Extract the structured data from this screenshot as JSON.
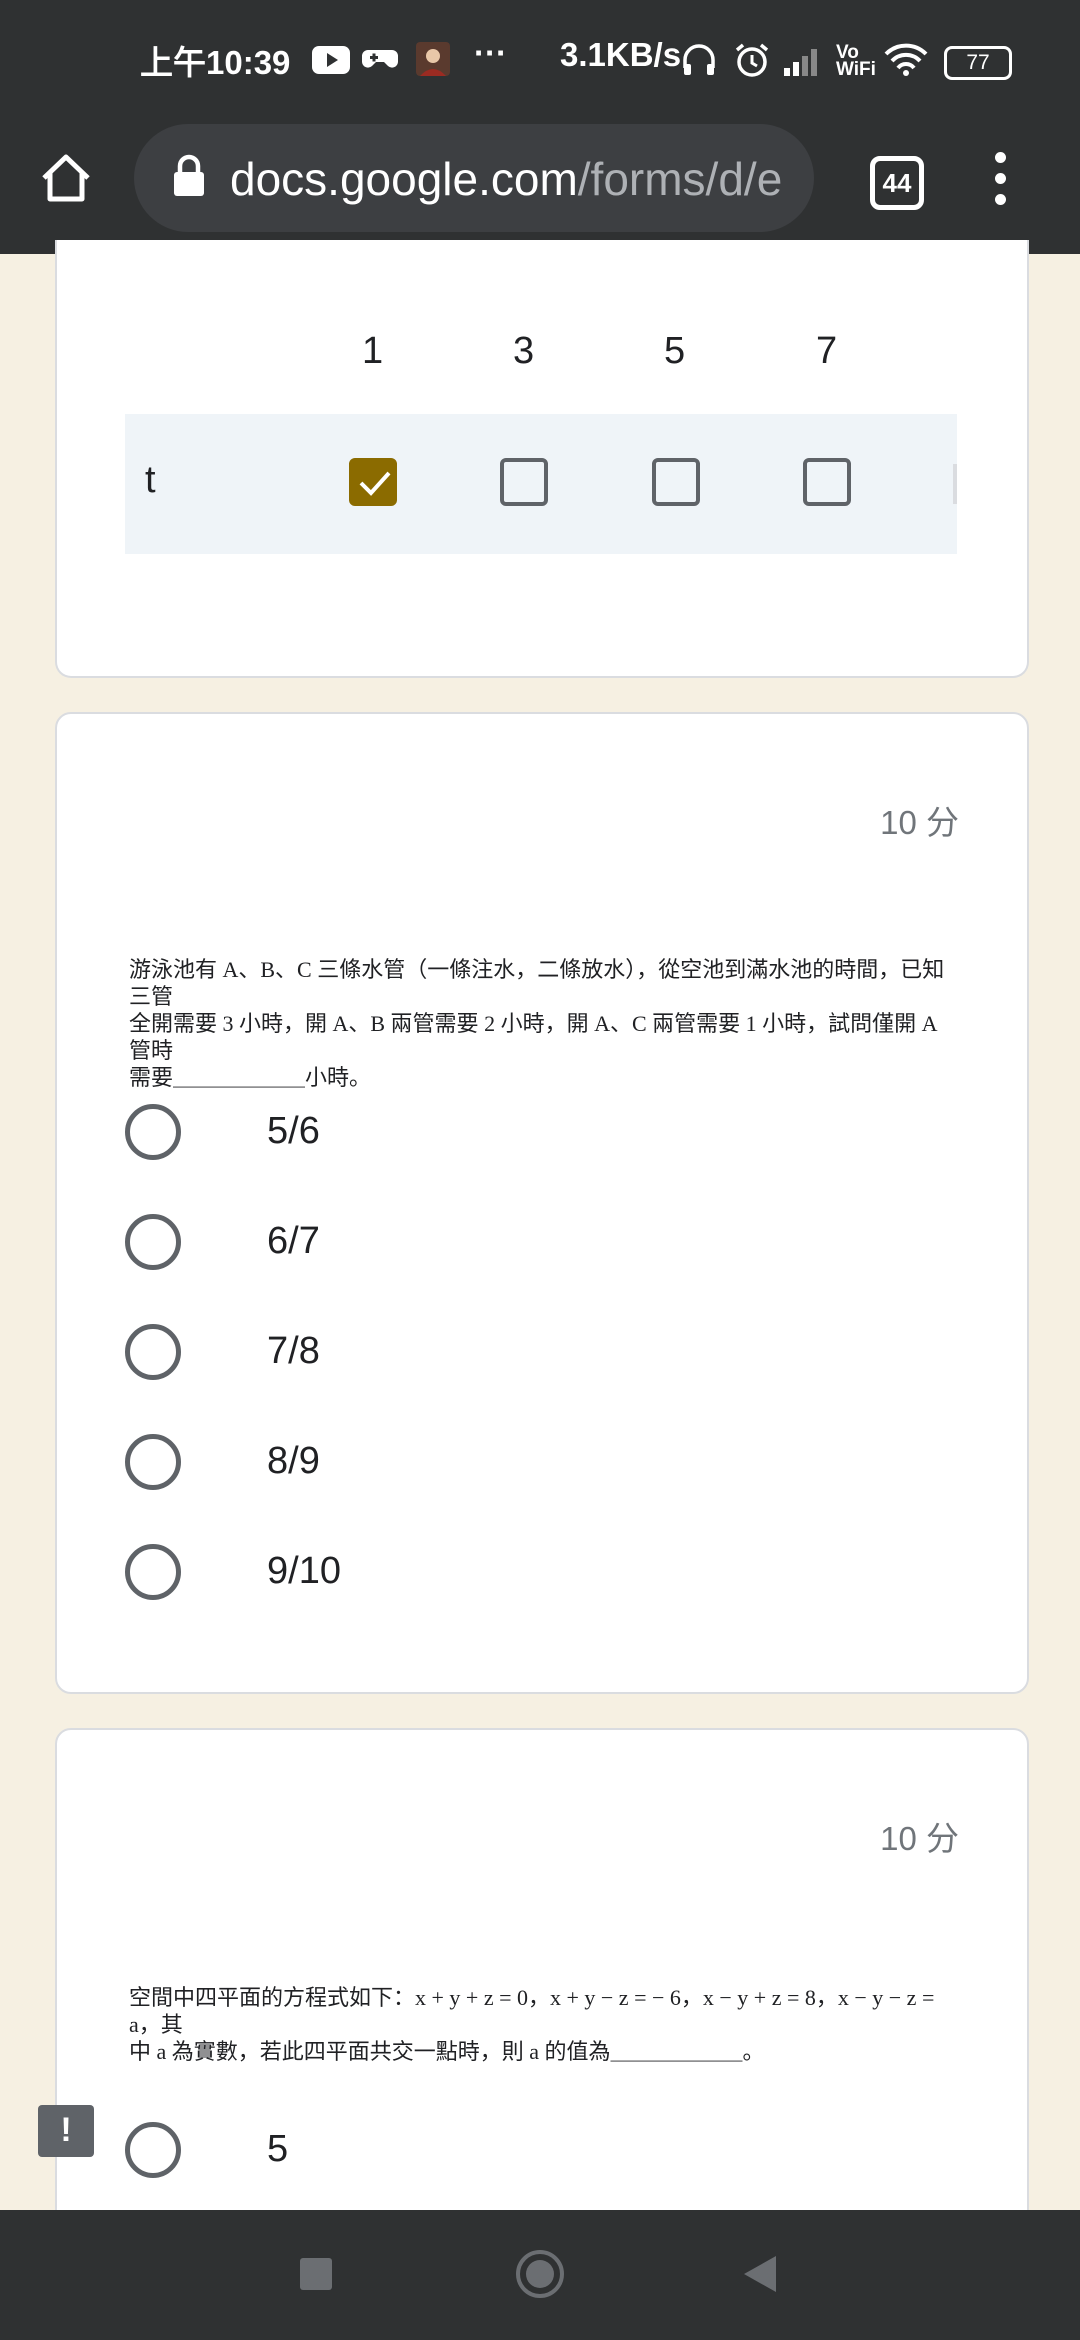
{
  "status_bar": {
    "time": "上午10:39",
    "more": "···",
    "net_speed": "3.1KB/s",
    "vowifi": "Vo WiFi",
    "battery": "77"
  },
  "browser": {
    "url_host": "docs.google.com",
    "url_path": "/forms/d/e",
    "tab_count": "44"
  },
  "grid_question": {
    "columns": [
      "1",
      "3",
      "5",
      "7"
    ],
    "row_label": "t",
    "checked_column": "1"
  },
  "question2": {
    "points": "10 分",
    "text_line1": "游泳池有 A、B、C 三條水管（一條注水，二條放水），從空池到滿水池的時間，已知三管",
    "text_line2": "全開需要 3 小時，開 A、B 兩管需要 2 小時，開 A、C 兩管需要 1 小時，試問僅開 A 管時",
    "text_line3": "需要＿＿＿＿＿＿小時。",
    "options": [
      "5/6",
      "6/7",
      "7/8",
      "8/9",
      "9/10"
    ]
  },
  "question3": {
    "points": "10 分",
    "text_line1": "空間中四平面的方程式如下：x + y + z = 0，x + y − z = − 6，x − y + z = 8，x − y − z = a，其",
    "text_line2": "中 a 為實數，若此四平面共交一點時，則 a 的值為＿＿＿＿＿＿。",
    "options": [
      "5"
    ]
  },
  "feedback": {
    "label": "!"
  }
}
